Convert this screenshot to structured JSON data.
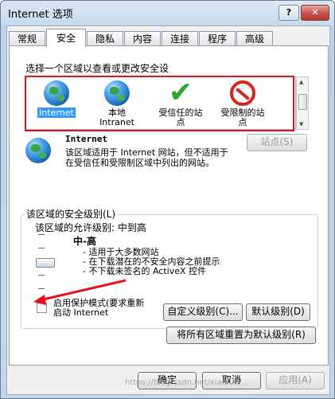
{
  "window": {
    "title": "Internet 选项",
    "help_label": "?",
    "close_label": "✕"
  },
  "tabs": [
    "常规",
    "安全",
    "隐私",
    "内容",
    "连接",
    "程序",
    "高级"
  ],
  "security": {
    "zone_prompt": "选择一个区域以查看或更改安全设",
    "zones": [
      {
        "name_line1": "Internet",
        "name_line2": "",
        "icon": "globe-icon"
      },
      {
        "name_line1": "本地",
        "name_line2": "Intranet",
        "icon": "intranet-globe-icon"
      },
      {
        "name_line1": "受信任的站",
        "name_line2": "点",
        "icon": "check-icon"
      },
      {
        "name_line1": "受限制的站",
        "name_line2": "点",
        "icon": "no-entry-icon"
      }
    ],
    "selected_zone": {
      "title": "Internet",
      "desc_line1": "该区域适用于 Internet 网站，但不适用于",
      "desc_line2": "在受信任和受限制区域中列出的网站。"
    },
    "sites_button": "站点(S)",
    "level_group_title": "该区域的安全级别(L)",
    "allowed_levels": "该区域的允许级别: 中到高",
    "level_name": "中-高",
    "level_bullets": [
      "- 适用于大多数网站",
      "- 在下载潜在的不安全内容之前提示",
      "- 不下载未签名的 ActiveX 控件"
    ],
    "protected_mode_label_line1": "启用保护模式(要求重新",
    "protected_mode_label_line2": "启动 Internet",
    "custom_level_button": "自定义级别(C)...",
    "default_level_button": "默认级别(D)",
    "reset_all_button": "将所有区域重置为默认级别(R)"
  },
  "footer": {
    "ok": "确定",
    "cancel": "取消",
    "apply": "应用(A)",
    "watermark": "https://blog.csdn.net/xiaoluo/..."
  }
}
